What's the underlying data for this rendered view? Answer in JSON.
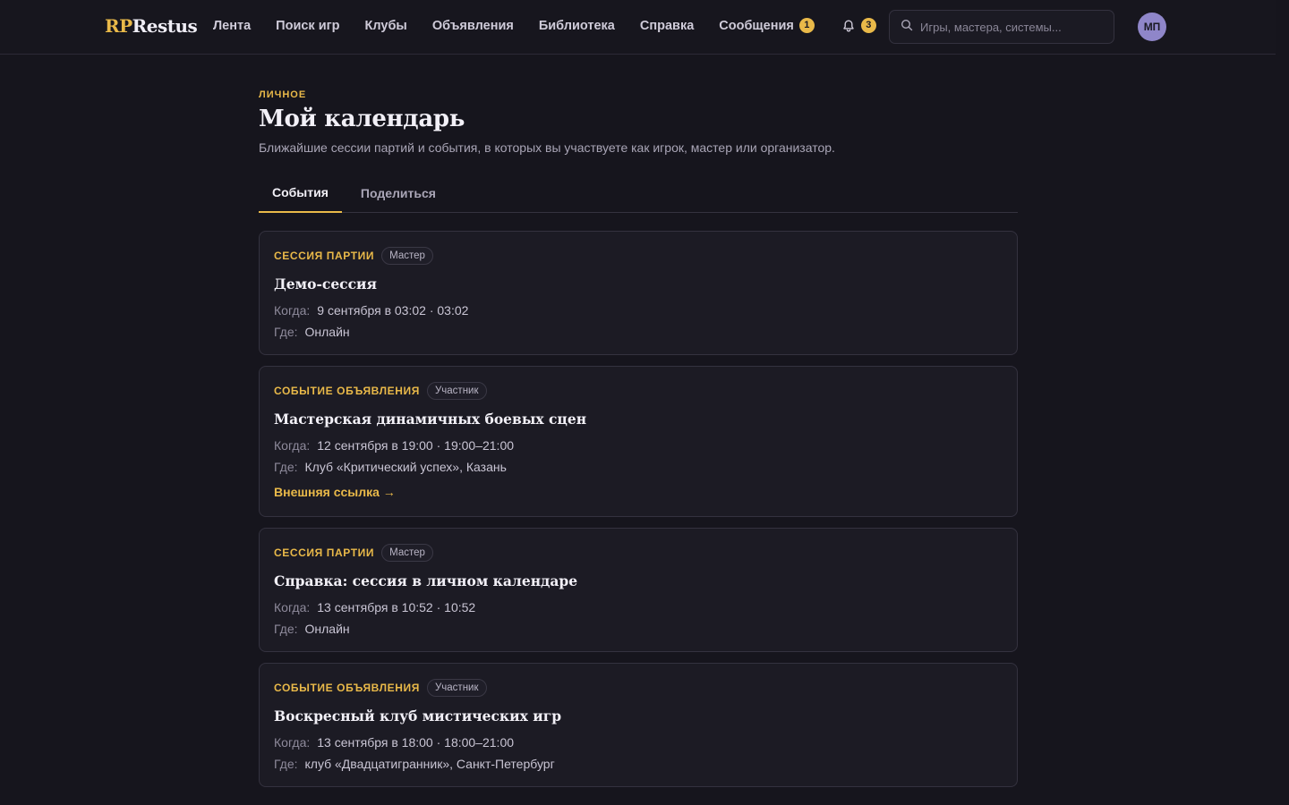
{
  "brand": {
    "logo_rp": "RP",
    "logo_rest": "Restus",
    "accent": "#e9b949"
  },
  "nav": {
    "items": [
      {
        "label": "Лента"
      },
      {
        "label": "Поиск игр"
      },
      {
        "label": "Клубы"
      },
      {
        "label": "Объявления"
      },
      {
        "label": "Библиотека"
      },
      {
        "label": "Справка"
      }
    ],
    "messages": {
      "label": "Сообщения",
      "count": "1"
    },
    "notifications": {
      "icon": "bell-icon",
      "count": "3"
    }
  },
  "search": {
    "placeholder": "Игры, мастера, системы..."
  },
  "user": {
    "initials": "МП"
  },
  "page": {
    "eyebrow": "ЛИЧНОЕ",
    "title": "Мой календарь",
    "subtitle": "Ближайшие сессии партий и события, в которых вы участвуете как игрок, мастер или организатор."
  },
  "tabs": [
    {
      "label": "События",
      "active": true
    },
    {
      "label": "Поделиться",
      "active": false
    }
  ],
  "labels": {
    "when": "Когда:",
    "where": "Где:"
  },
  "events": [
    {
      "kind": "СЕССИЯ ПАРТИИ",
      "role": "Мастер",
      "title": "Демо-сессия",
      "when": "9 сентября в 03:02 · 03:02",
      "where": "Онлайн"
    },
    {
      "kind": "СОБЫТИЕ ОБЪЯВЛЕНИЯ",
      "role": "Участник",
      "title": "Мастерская динамичных боевых сцен",
      "when": "12 сентября в 19:00 · 19:00–21:00",
      "where": "Клуб «Критический успех», Казань",
      "link": "Внешняя ссылка →"
    },
    {
      "kind": "СЕССИЯ ПАРТИИ",
      "role": "Мастер",
      "title": "Справка: сессия в личном календаре",
      "when": "13 сентября в 10:52 · 10:52",
      "where": "Онлайн"
    },
    {
      "kind": "СОБЫТИЕ ОБЪЯВЛЕНИЯ",
      "role": "Участник",
      "title": "Воскресный клуб мистических игр",
      "when": "13 сентября в 18:00 · 18:00–21:00",
      "where": "клуб «Двадцатигранник», Санкт-Петербург"
    }
  ]
}
